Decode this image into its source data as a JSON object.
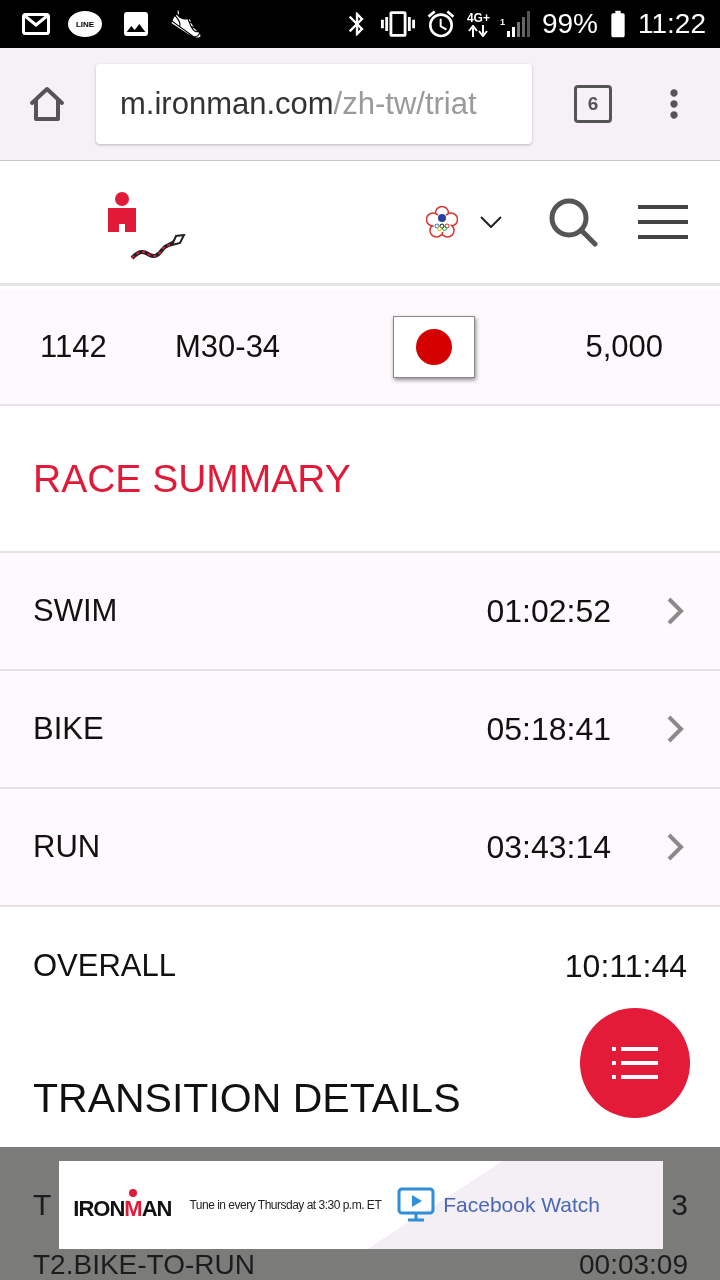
{
  "status_bar": {
    "app_badge": "LINE",
    "network": "4G+",
    "sim_slot": "1",
    "battery": "99%",
    "time": "11:22"
  },
  "browser": {
    "url_host": "m.ironman.com",
    "url_path": "/zh-tw/triat",
    "tab_count": "6"
  },
  "athlete": {
    "rank": "1142",
    "division": "M30-34",
    "points": "5,000"
  },
  "race_summary": {
    "title": "RACE SUMMARY",
    "splits": [
      {
        "label": "SWIM",
        "time": "01:02:52",
        "kind": "link"
      },
      {
        "label": "BIKE",
        "time": "05:18:41",
        "kind": "link"
      },
      {
        "label": "RUN",
        "time": "03:43:14",
        "kind": "link"
      },
      {
        "label": "OVERALL",
        "time": "10:11:44",
        "kind": "total"
      }
    ]
  },
  "transition_details": {
    "title": "TRANSITION DETAILS",
    "rows": [
      {
        "label": "T",
        "time": "3"
      },
      {
        "label": "T2.BIKE-TO-RUN",
        "time": "00:03:09"
      }
    ]
  },
  "ad": {
    "logo": {
      "before": "IRON",
      "mark": "M",
      "after": "AN"
    },
    "tagline": "Tune in every Thursday at 3:30 p.m. ET",
    "cta": "Facebook Watch"
  }
}
